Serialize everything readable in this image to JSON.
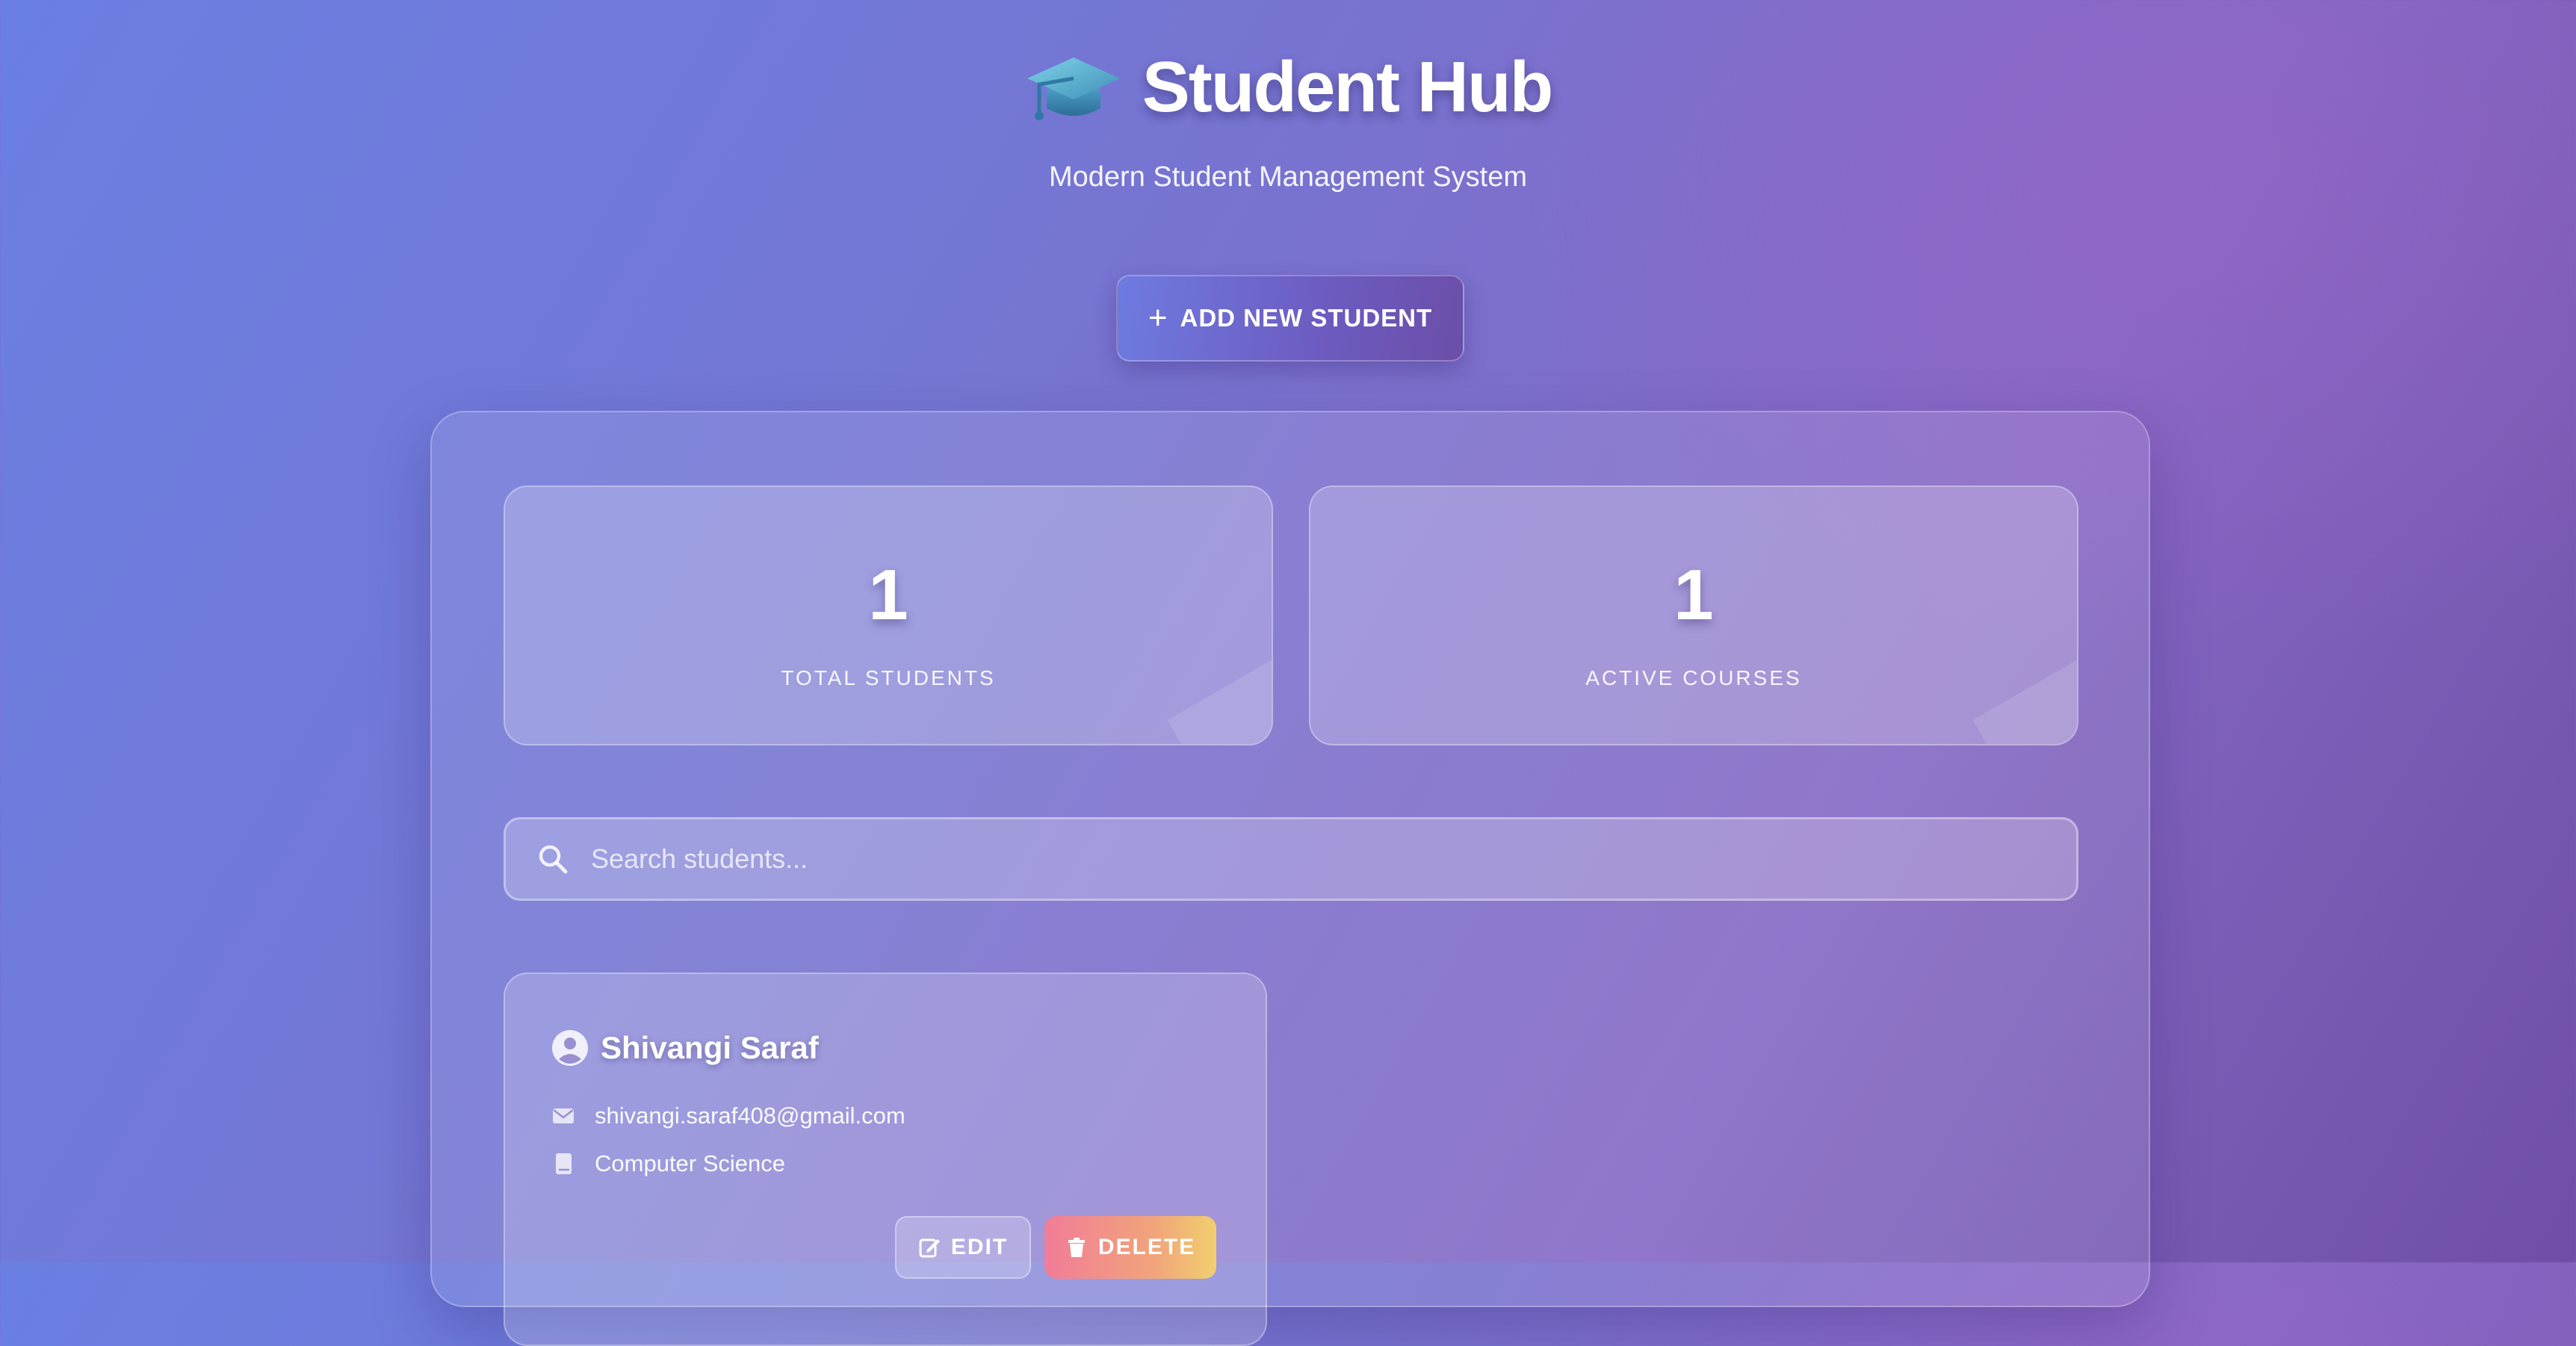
{
  "header": {
    "title": "Student Hub",
    "subtitle": "Modern Student Management System",
    "logo_icon": "graduation-cap-icon"
  },
  "actions": {
    "add_student_label": "ADD NEW STUDENT",
    "add_icon": "plus-icon"
  },
  "stats": [
    {
      "value": "1",
      "label": "TOTAL STUDENTS"
    },
    {
      "value": "1",
      "label": "ACTIVE COURSES"
    }
  ],
  "search": {
    "placeholder": "Search students...",
    "value": "",
    "icon": "search-icon"
  },
  "students": [
    {
      "name": "Shivangi Saraf",
      "email": "shivangi.saraf408@gmail.com",
      "course": "Computer Science",
      "edit_label": "EDIT",
      "delete_label": "DELETE"
    }
  ],
  "colors": {
    "background_start": "#6a7fe2",
    "background_end": "#6f4fa6",
    "delete_gradient_start": "#f17c98",
    "delete_gradient_end": "#f1cf6e"
  }
}
